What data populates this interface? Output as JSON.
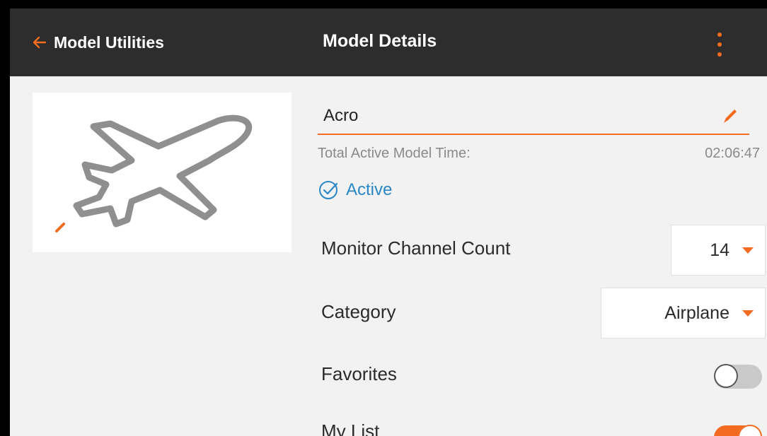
{
  "header": {
    "back_label": "Model Utilities",
    "title": "Model Details",
    "accent": "#f26b21"
  },
  "model": {
    "name": "Acro",
    "image_icon": "airplane-icon",
    "time_label": "Total Active Model Time:",
    "time_value": "02:06:47",
    "active_label": "Active",
    "active_color": "#2a87c5"
  },
  "settings": {
    "channel_count": {
      "label": "Monitor Channel Count",
      "value": "14"
    },
    "category": {
      "label": "Category",
      "value": "Airplane"
    },
    "favorites": {
      "label": "Favorites",
      "enabled": false
    },
    "my_list": {
      "label": "My List",
      "enabled": true
    }
  }
}
